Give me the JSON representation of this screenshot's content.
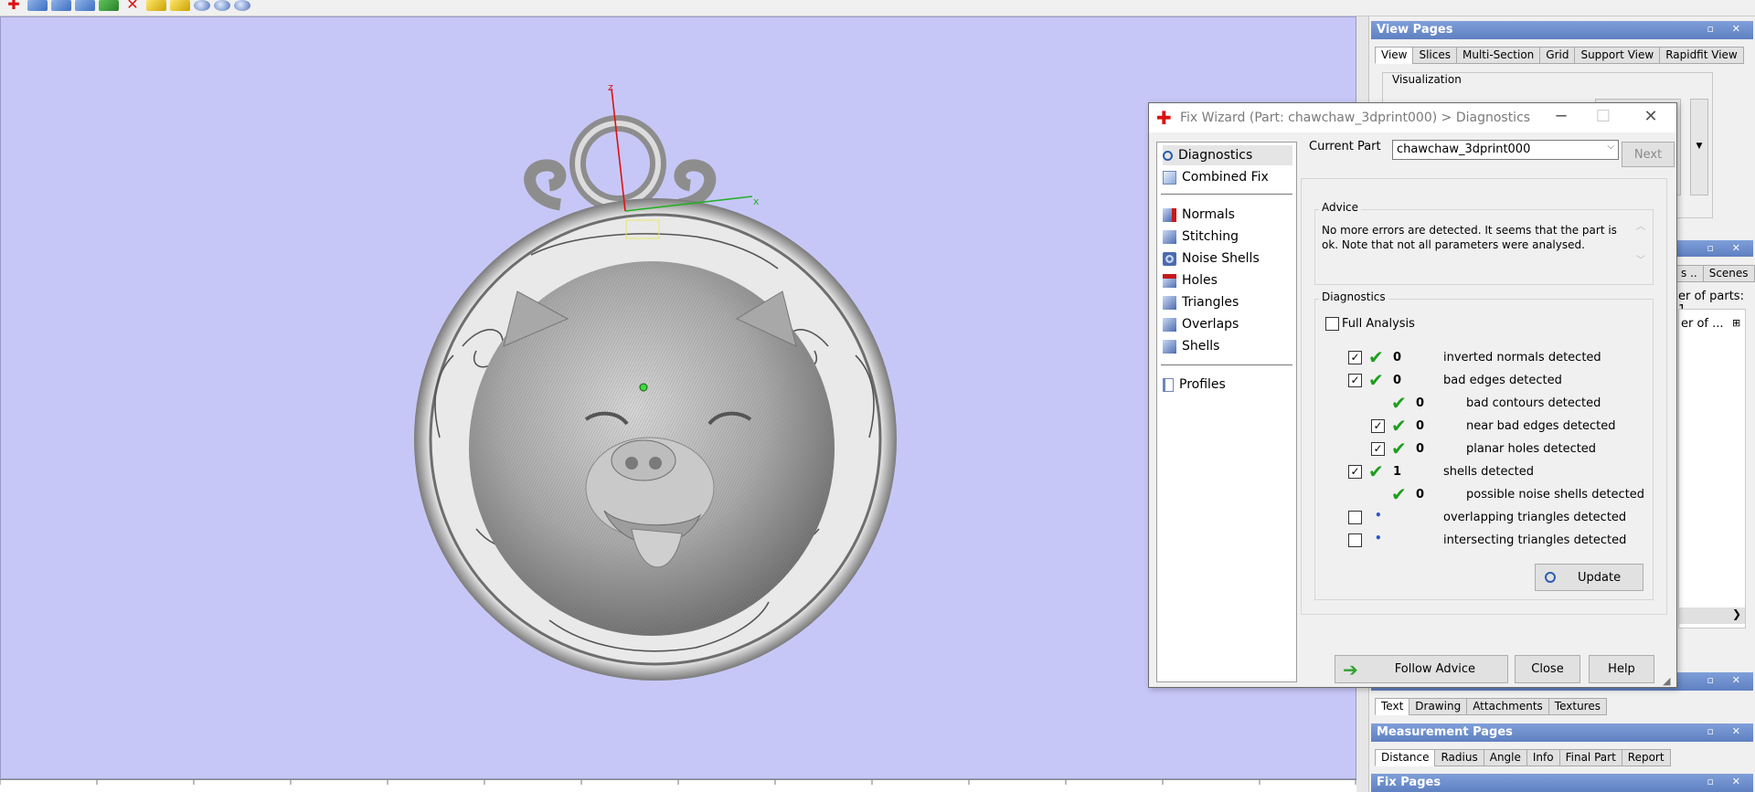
{
  "toolbar": {
    "icons": [
      "add-part-icon",
      "cube-icon",
      "cube-icon",
      "cube-icon",
      "green-tool-icon",
      "delete-icon",
      "measure-icon",
      "pin-icon",
      "sphere-icon",
      "sphere-icon",
      "sphere-icon"
    ]
  },
  "viewport": {
    "axis_labels": {
      "z": "z",
      "x": "x"
    },
    "background": "#c7c7f7"
  },
  "view_pages": {
    "title": "View Pages",
    "tabs": [
      "View",
      "Slices",
      "Multi-Section",
      "Grid",
      "Support View",
      "Rapidfit View"
    ],
    "active_tab": "View",
    "group": "Visualization"
  },
  "parts_pane": {
    "tabs": [
      "s ..",
      "Scenes"
    ],
    "count_label": "er of parts: 1",
    "column_header": "er of ..."
  },
  "text_pages": {
    "tabs": [
      "Text",
      "Drawing",
      "Attachments",
      "Textures"
    ],
    "active_tab": "Text"
  },
  "measurement_pages": {
    "title": "Measurement Pages",
    "tabs": [
      "Distance",
      "Radius",
      "Angle",
      "Info",
      "Final Part",
      "Report"
    ],
    "active_tab": "Distance"
  },
  "fix_pages": {
    "title": "Fix Pages"
  },
  "dialog": {
    "title": "Fix Wizard (Part: chawchaw_3dprint000) > Diagnostics",
    "nav": {
      "top": [
        "Diagnostics",
        "Combined Fix"
      ],
      "middle": [
        "Normals",
        "Stitching",
        "Noise Shells",
        "Holes",
        "Triangles",
        "Overlaps",
        "Shells"
      ],
      "bottom": [
        "Profiles"
      ]
    },
    "current_part_label": "Current Part",
    "current_part_value": "chawchaw_3dprint000",
    "next_button": "Next",
    "advice_legend": "Advice",
    "advice_text": "No more errors are detected. It seems that the part is ok. Note that not all parameters were analysed.",
    "diagnostics_legend": "Diagnostics",
    "full_analysis": "Full Analysis",
    "rows": [
      {
        "checked": true,
        "count": "0",
        "text": "inverted normals detected"
      },
      {
        "checked": true,
        "count": "0",
        "text": "bad edges detected"
      },
      {
        "count": "0",
        "text": "bad contours detected"
      },
      {
        "checked": true,
        "count": "0",
        "text": "near bad edges detected"
      },
      {
        "checked": true,
        "count": "0",
        "text": "planar holes detected"
      },
      {
        "checked": true,
        "count": "1",
        "text": "shells detected"
      },
      {
        "count": "0",
        "text": "possible noise shells detected"
      },
      {
        "checked": false,
        "text": "overlapping triangles detected"
      },
      {
        "checked": false,
        "text": "intersecting triangles detected"
      }
    ],
    "update_button": "Update",
    "follow_advice_button": "Follow Advice",
    "close_button": "Close",
    "help_button": "Help"
  }
}
